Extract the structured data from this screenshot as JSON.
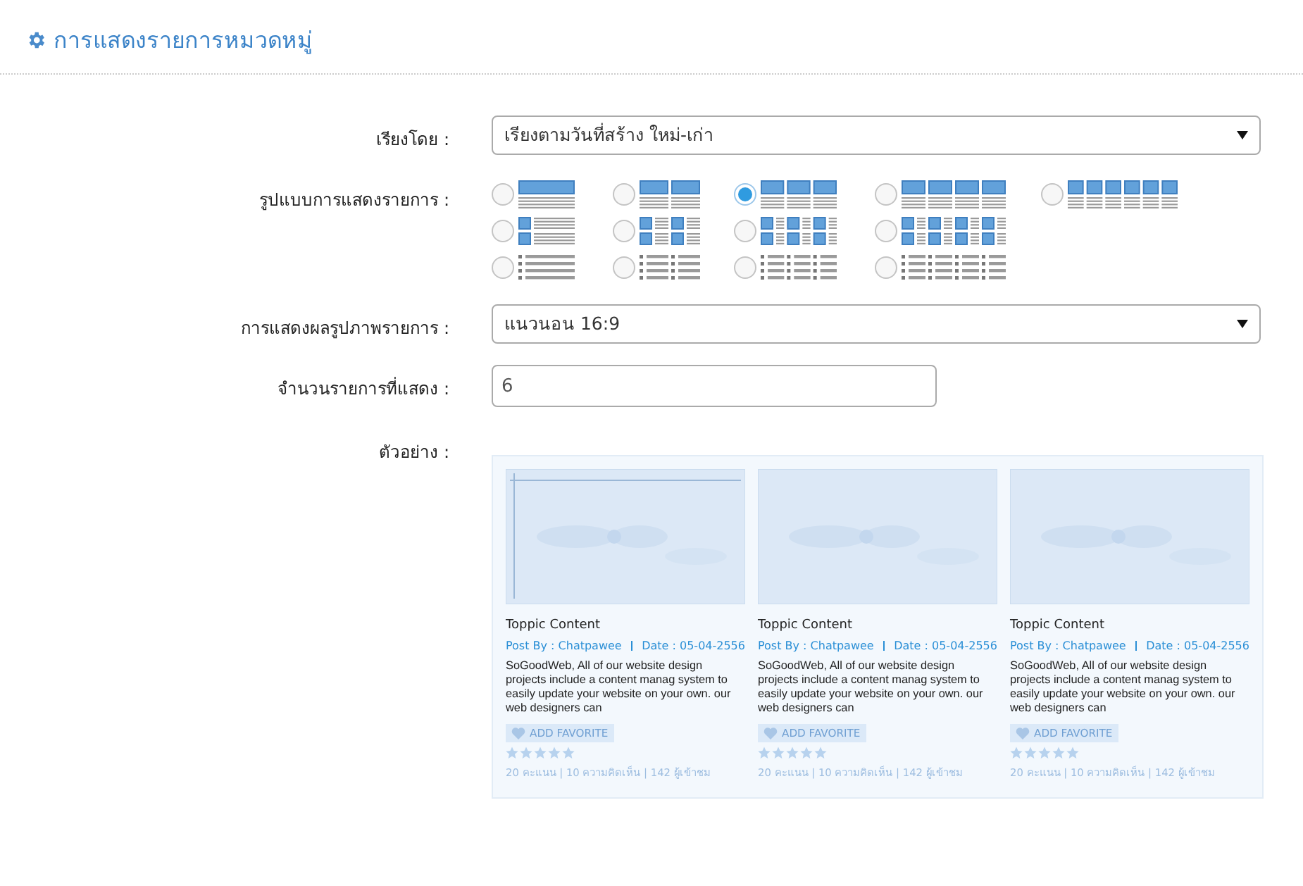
{
  "header": {
    "title": "การแสดงรายการหมวดหมู่"
  },
  "form": {
    "sort": {
      "label": "เรียงโดย :",
      "value": "เรียงตามวันที่สร้าง ใหม่-เก่า"
    },
    "layout": {
      "label": "รูปแบบการแสดงรายการ :",
      "rows": [
        {
          "options": [
            {
              "kind": "grid1",
              "selected": false
            },
            {
              "kind": "grid2",
              "selected": false
            },
            {
              "kind": "grid3",
              "selected": true
            },
            {
              "kind": "grid4",
              "selected": false
            },
            {
              "kind": "grid6",
              "selected": false
            }
          ]
        },
        {
          "options": [
            {
              "kind": "side1",
              "selected": false
            },
            {
              "kind": "side2",
              "selected": false
            },
            {
              "kind": "side3",
              "selected": false
            },
            {
              "kind": "side4",
              "selected": false
            }
          ]
        },
        {
          "options": [
            {
              "kind": "list1",
              "selected": false
            },
            {
              "kind": "list2",
              "selected": false
            },
            {
              "kind": "list3",
              "selected": false
            },
            {
              "kind": "list4",
              "selected": false
            }
          ]
        }
      ]
    },
    "image_display": {
      "label": "การแสดงผลรูปภาพรายการ :",
      "value": "แนวนอน 16:9"
    },
    "count": {
      "label": "จำนวนรายการที่แสดง :",
      "value": "6"
    },
    "preview": {
      "label": "ตัวอย่าง :",
      "cards": [
        {
          "title": "Toppic Content",
          "author": "Post By : Chatpawee",
          "date": "Date : 05-04-2556",
          "description": "SoGoodWeb, All of our website design projects include a content manag system to easily update your website on your own. our web designers can",
          "button": "ADD FAVORITE",
          "stars": 5,
          "stats": "20 คะแนน | 10 ความคิดเห็น | 142 ผู้เข้าชม"
        },
        {
          "title": "Toppic Content",
          "author": "Post By : Chatpawee",
          "date": "Date : 05-04-2556",
          "description": "SoGoodWeb, All of our website design projects include a content manag system to easily update your website on your own. our web designers can",
          "button": "ADD FAVORITE",
          "stars": 5,
          "stats": "20 คะแนน | 10 ความคิดเห็น | 142 ผู้เข้าชม"
        },
        {
          "title": "Toppic Content",
          "author": "Post By : Chatpawee",
          "date": "Date : 05-04-2556",
          "description": "SoGoodWeb, All of our website design projects include a content manag system to easily update your website on your own. our web designers can",
          "button": "ADD FAVORITE",
          "stars": 5,
          "stats": "20 คะแนน | 10 ความคิดเห็น | 142 ผู้เข้าชม"
        }
      ]
    }
  }
}
